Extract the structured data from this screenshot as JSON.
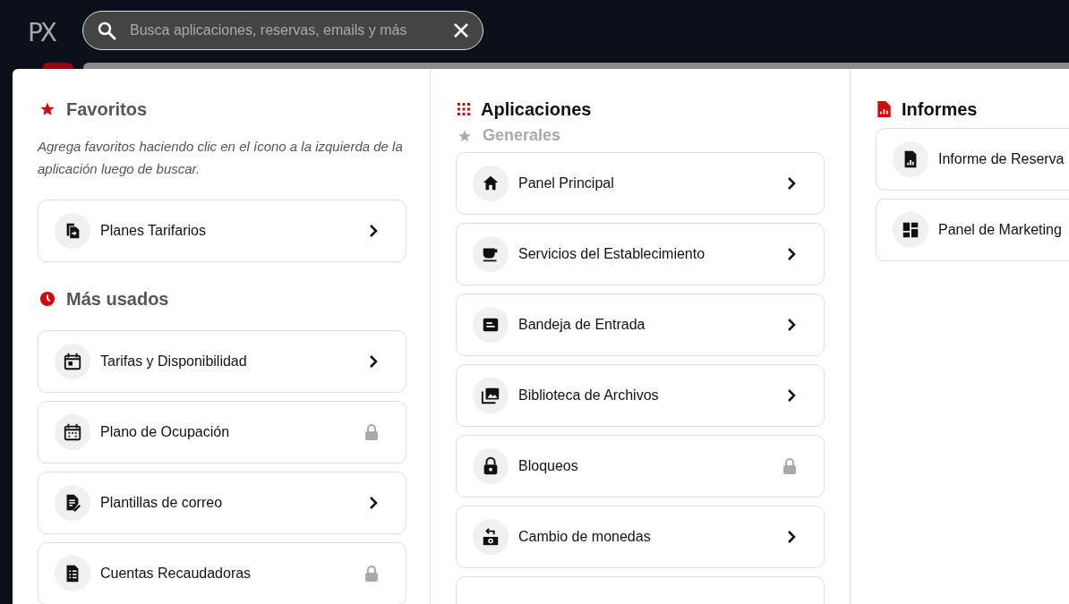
{
  "logo": {
    "text": "PX"
  },
  "search": {
    "placeholder": "Busca aplicaciones, reservas, emails y más"
  },
  "favorites": {
    "title": "Favoritos",
    "hint": "Agrega favoritos haciendo clic en el ícono a la izquierda de la aplicación luego de buscar.",
    "items": [
      {
        "label": "Planes Tarifarios",
        "kind": "link"
      }
    ]
  },
  "most_used": {
    "title": "Más usados",
    "items": [
      {
        "label": "Tarifas y Disponibilidad",
        "kind": "link"
      },
      {
        "label": "Plano de Ocupación",
        "kind": "locked"
      },
      {
        "label": "Plantillas de correo",
        "kind": "link"
      },
      {
        "label": "Cuentas Recaudadoras",
        "kind": "locked"
      }
    ]
  },
  "applications": {
    "title": "Aplicaciones",
    "group": "Generales",
    "items": [
      {
        "label": "Panel Principal",
        "kind": "link"
      },
      {
        "label": "Servicios del Establecimiento",
        "kind": "link"
      },
      {
        "label": "Bandeja de Entrada",
        "kind": "link"
      },
      {
        "label": "Biblioteca de Archivos",
        "kind": "link"
      },
      {
        "label": "Bloqueos",
        "kind": "locked"
      },
      {
        "label": "Cambio de monedas",
        "kind": "link"
      }
    ]
  },
  "reports": {
    "title": "Informes",
    "items": [
      {
        "label": "Informe de Reserva"
      },
      {
        "label": "Panel de Marketing"
      }
    ]
  }
}
